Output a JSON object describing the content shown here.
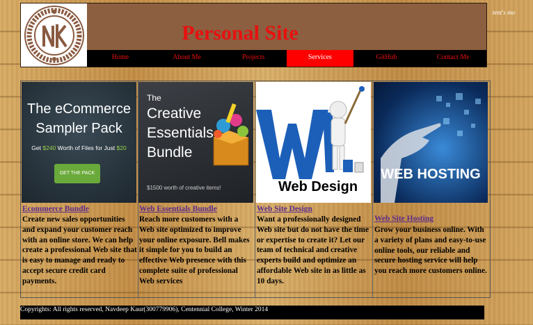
{
  "header": {
    "title": "Personal Site",
    "corner_text": "tent's mo"
  },
  "nav": {
    "items": [
      {
        "label": "Home"
      },
      {
        "label": "About Me"
      },
      {
        "label": "Projects"
      },
      {
        "label": "Services"
      },
      {
        "label": "GitHub"
      },
      {
        "label": "Contact Me"
      }
    ],
    "active": "Services"
  },
  "services": [
    {
      "title": "Ecommerce Bundle",
      "description": "Create new sales opportunities and expand your customer reach with an online store. We can help create a professional Web site that is easy to manage and ready to accept secure credit card payments.",
      "image": {
        "line1": "The eCommerce",
        "line2": "Sampler Pack",
        "sub_prefix": "Get ",
        "sub_amount1": "$240",
        "sub_mid": " Worth of Files for Just ",
        "sub_amount2": "$20",
        "button": "GET THE PACK"
      }
    },
    {
      "title": "Web Essentials Bundle",
      "description": "Reach more customers with a Web site optimized to improve your online exposure. Bell makes it simple for you to build an effective Web presence with this complete suite of professional Web services",
      "image": {
        "line1": "The",
        "line2": "Creative",
        "line3": "Essentials",
        "line4": "Bundle",
        "footer": "$1500 worth of creative items!"
      }
    },
    {
      "title": "Web Site Design",
      "description": "Want a professionally designed Web site but do not have the time or expertise to create it? Let our team of technical and creative experts build and optimize an affordable Web site in as little as 10 days.",
      "image": {
        "caption": "Web Design"
      }
    },
    {
      "title": "Web Site Hosting",
      "description": "Grow your business online. With a variety of plans and easy-to-use online tools, our reliable and secure hosting service will help you reach more customers online.",
      "image": {
        "caption": "WEB HOSTING"
      }
    }
  ],
  "footer": {
    "text": "Copyrights: All rights reserved, Navdeep Kaur(300779906), Centennial College, Winter 2014"
  },
  "colors": {
    "header_bg": "#8b5f3f",
    "title": "#e81010",
    "nav_bg": "#000000",
    "nav_active": "#ff0000",
    "link": "#5b2b8a"
  }
}
